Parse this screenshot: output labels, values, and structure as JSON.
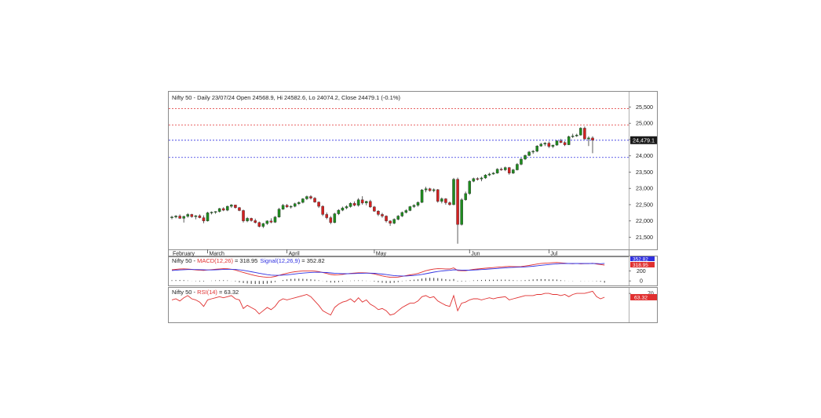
{
  "chart_data": [
    {
      "type": "candlestick",
      "header": "Nifty 50 - Daily 23/07/24 Open 24568.9, Hi 24582.6, Lo 24074.2, Close 24479.1 (-0.1%)",
      "last_close_label": "24,479.1",
      "y_ticks": [
        "21,500",
        "22,000",
        "22,500",
        "23,000",
        "23,500",
        "24,000",
        "24,500",
        "25,000",
        "25,500"
      ],
      "y_tick_values": [
        21500,
        22000,
        22500,
        23000,
        23500,
        24000,
        24500,
        25000,
        25500
      ],
      "ylim": [
        21150,
        25800
      ],
      "month_labels": [
        "February",
        "March",
        "April",
        "May",
        "Jun",
        "Jul"
      ],
      "month_start_index": [
        0,
        9,
        29,
        51,
        75,
        95
      ],
      "reference_lines": [
        {
          "value": 25450,
          "color": "#e03030"
        },
        {
          "value": 24950,
          "color": "#e03030"
        },
        {
          "value": 24479,
          "color": "#3030e0"
        },
        {
          "value": 23950,
          "color": "#3030e0"
        }
      ],
      "up_color": "#1e8c1e",
      "down_color": "#d42020",
      "candles": [
        [
          22100,
          22160,
          22050,
          22120
        ],
        [
          22120,
          22180,
          22080,
          22150
        ],
        [
          22150,
          22200,
          22060,
          22080
        ],
        [
          22080,
          22160,
          21950,
          22140
        ],
        [
          22140,
          22240,
          22100,
          22200
        ],
        [
          22200,
          22220,
          22100,
          22130
        ],
        [
          22130,
          22180,
          22050,
          22160
        ],
        [
          22160,
          22200,
          22080,
          22100
        ],
        [
          22100,
          22170,
          21930,
          22000
        ],
        [
          22000,
          22280,
          21980,
          22250
        ],
        [
          22250,
          22290,
          22200,
          22270
        ],
        [
          22270,
          22300,
          22220,
          22290
        ],
        [
          22290,
          22400,
          22260,
          22380
        ],
        [
          22380,
          22420,
          22300,
          22330
        ],
        [
          22330,
          22470,
          22300,
          22450
        ],
        [
          22450,
          22520,
          22400,
          22490
        ],
        [
          22490,
          22500,
          22380,
          22410
        ],
        [
          22410,
          22430,
          22300,
          22320
        ],
        [
          22320,
          22350,
          21950,
          22000
        ],
        [
          22000,
          22120,
          21960,
          22080
        ],
        [
          22080,
          22100,
          21980,
          22010
        ],
        [
          22010,
          22070,
          21920,
          21950
        ],
        [
          21950,
          21980,
          21800,
          21830
        ],
        [
          21830,
          21940,
          21780,
          21920
        ],
        [
          21920,
          22020,
          21880,
          22000
        ],
        [
          22000,
          22080,
          21930,
          21960
        ],
        [
          21960,
          22150,
          21940,
          22120
        ],
        [
          22120,
          22400,
          22100,
          22360
        ],
        [
          22360,
          22520,
          22340,
          22480
        ],
        [
          22480,
          22520,
          22400,
          22430
        ],
        [
          22430,
          22480,
          22380,
          22450
        ],
        [
          22450,
          22560,
          22420,
          22530
        ],
        [
          22530,
          22600,
          22490,
          22570
        ],
        [
          22570,
          22700,
          22540,
          22680
        ],
        [
          22680,
          22780,
          22640,
          22750
        ],
        [
          22750,
          22790,
          22660,
          22700
        ],
        [
          22700,
          22730,
          22560,
          22580
        ],
        [
          22580,
          22600,
          22400,
          22450
        ],
        [
          22450,
          22480,
          22150,
          22200
        ],
        [
          22200,
          22260,
          22050,
          22100
        ],
        [
          22100,
          22150,
          21900,
          21950
        ],
        [
          21950,
          22250,
          21930,
          22220
        ],
        [
          22220,
          22360,
          22180,
          22330
        ],
        [
          22330,
          22440,
          22300,
          22400
        ],
        [
          22400,
          22480,
          22360,
          22440
        ],
        [
          22440,
          22570,
          22410,
          22540
        ],
        [
          22540,
          22600,
          22450,
          22480
        ],
        [
          22480,
          22700,
          22440,
          22650
        ],
        [
          22650,
          22760,
          22500,
          22550
        ],
        [
          22550,
          22620,
          22480,
          22600
        ],
        [
          22600,
          22650,
          22400,
          22430
        ],
        [
          22430,
          22460,
          22280,
          22300
        ],
        [
          22300,
          22330,
          22150,
          22200
        ],
        [
          22200,
          22250,
          22100,
          22150
        ],
        [
          22150,
          22170,
          21950,
          22000
        ],
        [
          22000,
          22020,
          21850,
          21930
        ],
        [
          21930,
          22080,
          21900,
          22050
        ],
        [
          22050,
          22180,
          22020,
          22150
        ],
        [
          22150,
          22290,
          22120,
          22260
        ],
        [
          22260,
          22360,
          22230,
          22320
        ],
        [
          22320,
          22460,
          22300,
          22440
        ],
        [
          22440,
          22510,
          22400,
          22480
        ],
        [
          22480,
          22600,
          22440,
          22570
        ],
        [
          22570,
          22980,
          22550,
          22950
        ],
        [
          22950,
          23050,
          22880,
          22990
        ],
        [
          22990,
          23020,
          22900,
          22930
        ],
        [
          22930,
          23000,
          22880,
          22960
        ],
        [
          22960,
          22980,
          22560,
          22600
        ],
        [
          22600,
          22720,
          22540,
          22680
        ],
        [
          22680,
          22700,
          22500,
          22560
        ],
        [
          22560,
          22600,
          22470,
          22500
        ],
        [
          22500,
          23320,
          22480,
          23280
        ],
        [
          23280,
          23330,
          21300,
          21890
        ],
        [
          21890,
          22700,
          21860,
          22650
        ],
        [
          22650,
          22900,
          22620,
          22840
        ],
        [
          22840,
          23250,
          22800,
          23220
        ],
        [
          23220,
          23330,
          23190,
          23300
        ],
        [
          23300,
          23340,
          23240,
          23290
        ],
        [
          23290,
          23360,
          23220,
          23320
        ],
        [
          23320,
          23440,
          23290,
          23410
        ],
        [
          23410,
          23480,
          23380,
          23440
        ],
        [
          23440,
          23500,
          23420,
          23470
        ],
        [
          23470,
          23620,
          23450,
          23590
        ],
        [
          23590,
          23640,
          23540,
          23570
        ],
        [
          23570,
          23670,
          23530,
          23640
        ],
        [
          23640,
          23660,
          23420,
          23470
        ],
        [
          23470,
          23600,
          23440,
          23570
        ],
        [
          23570,
          23780,
          23550,
          23740
        ],
        [
          23740,
          23930,
          23710,
          23900
        ],
        [
          23900,
          24040,
          23870,
          24010
        ],
        [
          24010,
          24150,
          23990,
          24120
        ],
        [
          24120,
          24180,
          24060,
          24140
        ],
        [
          24140,
          24330,
          24110,
          24300
        ],
        [
          24300,
          24400,
          24280,
          24360
        ],
        [
          24360,
          24420,
          24300,
          24390
        ],
        [
          24390,
          24440,
          24240,
          24290
        ],
        [
          24290,
          24340,
          24240,
          24330
        ],
        [
          24330,
          24480,
          24310,
          24460
        ],
        [
          24460,
          24520,
          24390,
          24410
        ],
        [
          24410,
          24450,
          24300,
          24340
        ],
        [
          24340,
          24620,
          24330,
          24590
        ],
        [
          24590,
          24680,
          24550,
          24610
        ],
        [
          24610,
          24680,
          24580,
          24640
        ],
        [
          24640,
          24880,
          24620,
          24850
        ],
        [
          24850,
          24900,
          24500,
          24520
        ],
        [
          24520,
          24600,
          24300,
          24550
        ],
        [
          24550,
          24600,
          24080,
          24480
        ]
      ]
    },
    {
      "type": "line",
      "legend_prefix": "Nifty 50 - ",
      "macd_label": "MACD(12,26)",
      "macd_value": "= 318.95",
      "signal_label": "Signal(12,26,9)",
      "signal_value": "= 352.82",
      "y_ticks": [
        "200",
        "0"
      ],
      "y_tick_values": [
        200,
        0
      ],
      "ylim": [
        -60,
        430
      ],
      "tag_signal": "352.82",
      "tag_macd": "318.95",
      "series": [
        {
          "name": "MACD(12,26)",
          "color": "#e03030",
          "values": [
            225,
            233,
            240,
            243,
            238,
            232,
            222,
            215,
            212,
            222,
            228,
            235,
            242,
            246,
            245,
            236,
            220,
            193,
            170,
            148,
            126,
            108,
            92,
            80,
            72,
            76,
            90,
            112,
            135,
            155,
            172,
            185,
            195,
            200,
            203,
            202,
            198,
            188,
            170,
            150,
            130,
            122,
            125,
            132,
            142,
            152,
            158,
            164,
            165,
            162,
            154,
            140,
            120,
            102,
            86,
            74,
            72,
            78,
            92,
            108,
            122,
            135,
            150,
            178,
            205,
            225,
            238,
            246,
            245,
            242,
            240,
            262,
            210,
            205,
            206,
            220,
            232,
            240,
            248,
            256,
            262,
            268,
            276,
            282,
            288,
            292,
            290,
            286,
            290,
            300,
            312,
            326,
            340,
            352,
            358,
            362,
            368,
            372,
            364,
            358,
            350,
            346,
            352,
            345,
            348,
            348,
            355,
            340,
            330,
            319
          ]
        },
        {
          "name": "Signal(12,26,9)",
          "color": "#3030e0",
          "values": [
            210,
            215,
            221,
            226,
            229,
            230,
            229,
            227,
            224,
            222,
            222,
            224,
            228,
            231,
            234,
            234,
            231,
            223,
            213,
            199,
            185,
            170,
            155,
            140,
            127,
            117,
            112,
            112,
            117,
            124,
            132,
            141,
            150,
            158,
            165,
            170,
            174,
            175,
            173,
            169,
            162,
            155,
            150,
            146,
            145,
            147,
            149,
            152,
            155,
            157,
            157,
            154,
            147,
            138,
            128,
            117,
            108,
            102,
            99,
            100,
            104,
            111,
            119,
            131,
            146,
            162,
            177,
            190,
            200,
            208,
            214,
            224,
            221,
            218,
            216,
            217,
            220,
            224,
            229,
            234,
            240,
            245,
            251,
            257,
            263,
            269,
            273,
            276,
            279,
            283,
            289,
            296,
            305,
            315,
            323,
            331,
            338,
            345,
            349,
            351,
            352,
            351,
            352,
            351,
            351,
            351,
            352,
            350,
            347,
            353
          ]
        }
      ],
      "histogram": [
        15,
        18,
        19,
        17,
        9,
        2,
        -7,
        -12,
        -12,
        0,
        6,
        11,
        14,
        15,
        11,
        2,
        -11,
        -30,
        -43,
        -51,
        -59,
        -62,
        -63,
        -60,
        -55,
        -41,
        -22,
        0,
        18,
        31,
        40,
        44,
        45,
        42,
        38,
        32,
        24,
        13,
        -3,
        -19,
        -32,
        -33,
        -25,
        -14,
        -3,
        5,
        9,
        12,
        10,
        5,
        -3,
        -14,
        -27,
        -36,
        -42,
        -43,
        -36,
        -24,
        -7,
        8,
        18,
        24,
        31,
        47,
        59,
        63,
        61,
        56,
        45,
        34,
        26,
        38,
        -11,
        -13,
        -10,
        3,
        12,
        16,
        19,
        22,
        22,
        23,
        25,
        25,
        25,
        23,
        17,
        10,
        11,
        17,
        23,
        30,
        35,
        37,
        35,
        31,
        30,
        27,
        15,
        7,
        -2,
        -5,
        0,
        -6,
        -3,
        -3,
        3,
        -10,
        -17,
        -34
      ]
    },
    {
      "type": "line",
      "legend_prefix": "Nifty 50 - ",
      "rsi_label": "RSI(14)",
      "rsi_value": "= 63.32",
      "y_ticks": [
        "70"
      ],
      "y_tick_values": [
        70
      ],
      "ylim": [
        18,
        76
      ],
      "tag_value": "63.32",
      "series": [
        {
          "name": "RSI(14)",
          "color": "#e03030",
          "values": [
            58,
            60,
            56,
            62,
            66,
            60,
            58,
            54,
            46,
            58,
            60,
            62,
            64,
            62,
            64,
            66,
            60,
            58,
            42,
            48,
            44,
            40,
            32,
            38,
            44,
            40,
            46,
            56,
            60,
            58,
            60,
            62,
            64,
            66,
            68,
            64,
            56,
            48,
            38,
            34,
            30,
            44,
            50,
            54,
            56,
            60,
            54,
            62,
            54,
            58,
            50,
            46,
            40,
            42,
            38,
            30,
            32,
            38,
            44,
            48,
            52,
            52,
            56,
            64,
            66,
            62,
            64,
            56,
            52,
            48,
            46,
            66,
            38,
            52,
            54,
            58,
            60,
            60,
            58,
            60,
            62,
            60,
            62,
            63,
            64,
            58,
            60,
            62,
            64,
            66,
            66,
            66,
            68,
            68,
            70,
            70,
            68,
            68,
            66,
            68,
            64,
            68,
            70,
            70,
            70,
            72,
            74,
            64,
            60,
            63
          ]
        }
      ]
    }
  ]
}
